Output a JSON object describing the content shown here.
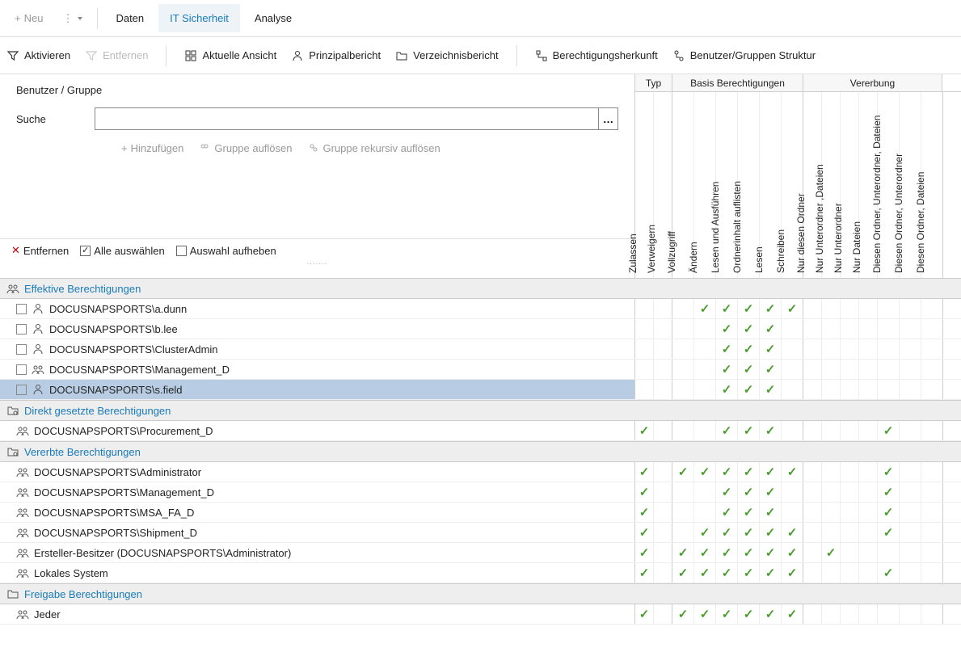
{
  "topbar": {
    "neu": "Neu",
    "tabs": {
      "daten": "Daten",
      "sicherheit": "IT Sicherheit",
      "analyse": "Analyse"
    }
  },
  "subbar": {
    "aktivieren": "Aktivieren",
    "entfernen": "Entfernen",
    "ansicht": "Aktuelle Ansicht",
    "prinzipal": "Prinzipalbericht",
    "verzeichnis": "Verzeichnisbericht",
    "herkunft": "Berechtigungsherkunft",
    "struktur": "Benutzer/Gruppen Struktur"
  },
  "search": {
    "title": "Benutzer / Gruppe",
    "label": "Suche",
    "hinzu": "Hinzufügen",
    "aufloesen": "Gruppe auflösen",
    "rekursiv": "Gruppe rekursiv auflösen"
  },
  "filterbar": {
    "entfernen": "Entfernen",
    "alle": "Alle auswählen",
    "aufheben": "Auswahl aufheben"
  },
  "headers": {
    "typ": "Typ",
    "basis": "Basis Berechtigungen",
    "vererbung": "Vererbung",
    "cols": [
      "Zulassen",
      "Verweigern",
      "Vollzugriff",
      "Ändern",
      "Lesen und Ausführen",
      "Ordnerinhalt auflisten",
      "Lesen",
      "Schreiben",
      "Nur diesen Ordner",
      "Nur Unterordner ,Dateien",
      "Nur Unterordner",
      "Nur Dateien",
      "Diesen Ordner, Unterordner, Dateien",
      "Diesen Ordner, Unterordner",
      "Diesen Ordner, Dateien"
    ]
  },
  "sections": {
    "effektiv": "Effektive Berechtigungen",
    "direkt": "Direkt gesetzte Berechtigungen",
    "vererbt": "Vererbte Berechtigungen",
    "freigabe": "Freigabe Berechtigungen"
  },
  "rows": {
    "effektiv": [
      {
        "icon": "user",
        "name": "DOCUSNAPSPORTS\\a.dunn",
        "cb": true,
        "sel": false,
        "perms": [
          0,
          0,
          0,
          1,
          1,
          1,
          1,
          1,
          0,
          0,
          0,
          0,
          0,
          0,
          0
        ]
      },
      {
        "icon": "user",
        "name": "DOCUSNAPSPORTS\\b.lee",
        "cb": true,
        "sel": false,
        "perms": [
          0,
          0,
          0,
          0,
          1,
          1,
          1,
          0,
          0,
          0,
          0,
          0,
          0,
          0,
          0
        ]
      },
      {
        "icon": "user",
        "name": "DOCUSNAPSPORTS\\ClusterAdmin",
        "cb": true,
        "sel": false,
        "perms": [
          0,
          0,
          0,
          0,
          1,
          1,
          1,
          0,
          0,
          0,
          0,
          0,
          0,
          0,
          0
        ]
      },
      {
        "icon": "group",
        "name": "DOCUSNAPSPORTS\\Management_D",
        "cb": true,
        "sel": false,
        "perms": [
          0,
          0,
          0,
          0,
          1,
          1,
          1,
          0,
          0,
          0,
          0,
          0,
          0,
          0,
          0
        ]
      },
      {
        "icon": "user",
        "name": "DOCUSNAPSPORTS\\s.field",
        "cb": true,
        "sel": true,
        "perms": [
          0,
          0,
          0,
          0,
          1,
          1,
          1,
          0,
          0,
          0,
          0,
          0,
          0,
          0,
          0
        ]
      }
    ],
    "direkt": [
      {
        "icon": "group2",
        "name": "DOCUSNAPSPORTS\\Procurement_D",
        "cb": false,
        "perms": [
          1,
          0,
          0,
          0,
          1,
          1,
          1,
          0,
          0,
          0,
          0,
          0,
          1,
          0,
          0
        ]
      }
    ],
    "vererbt": [
      {
        "icon": "group2",
        "name": "DOCUSNAPSPORTS\\Administrator",
        "cb": false,
        "perms": [
          1,
          0,
          1,
          1,
          1,
          1,
          1,
          1,
          0,
          0,
          0,
          0,
          1,
          0,
          0
        ]
      },
      {
        "icon": "group2",
        "name": "DOCUSNAPSPORTS\\Management_D",
        "cb": false,
        "perms": [
          1,
          0,
          0,
          0,
          1,
          1,
          1,
          0,
          0,
          0,
          0,
          0,
          1,
          0,
          0
        ]
      },
      {
        "icon": "group2",
        "name": "DOCUSNAPSPORTS\\MSA_FA_D",
        "cb": false,
        "perms": [
          1,
          0,
          0,
          0,
          1,
          1,
          1,
          0,
          0,
          0,
          0,
          0,
          1,
          0,
          0
        ]
      },
      {
        "icon": "group2",
        "name": "DOCUSNAPSPORTS\\Shipment_D",
        "cb": false,
        "perms": [
          1,
          0,
          0,
          1,
          1,
          1,
          1,
          1,
          0,
          0,
          0,
          0,
          1,
          0,
          0
        ]
      },
      {
        "icon": "group2",
        "name": "Ersteller-Besitzer (DOCUSNAPSPORTS\\Administrator)",
        "cb": false,
        "perms": [
          1,
          0,
          1,
          1,
          1,
          1,
          1,
          1,
          0,
          1,
          0,
          0,
          0,
          0,
          0
        ]
      },
      {
        "icon": "group2",
        "name": "Lokales System",
        "cb": false,
        "perms": [
          1,
          0,
          1,
          1,
          1,
          1,
          1,
          1,
          0,
          0,
          0,
          0,
          1,
          0,
          0
        ]
      }
    ],
    "freigabe": [
      {
        "icon": "group2",
        "name": "Jeder",
        "cb": false,
        "perms": [
          1,
          0,
          1,
          1,
          1,
          1,
          1,
          1,
          0,
          0,
          0,
          0,
          0,
          0,
          0
        ]
      }
    ]
  }
}
